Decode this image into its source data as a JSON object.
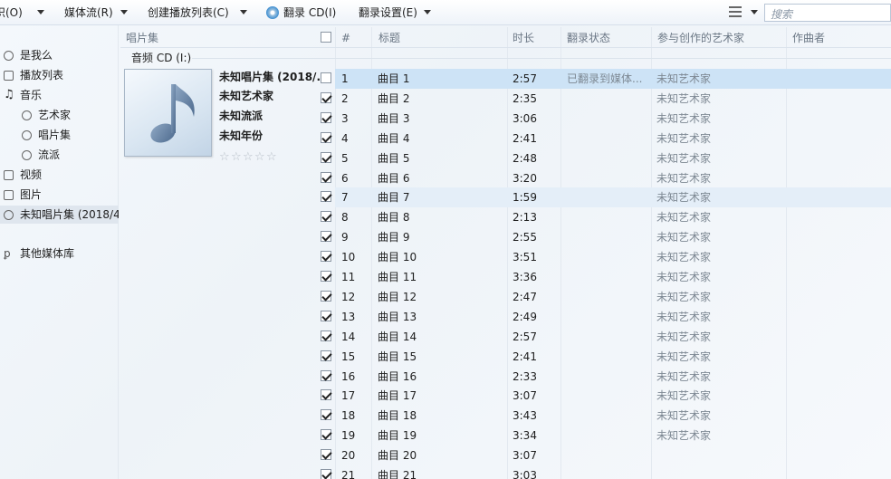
{
  "toolbar": {
    "organize": "织(O)",
    "stream": "媒体流(R)",
    "create_playlist": "创建播放列表(C)",
    "rip_cd": "翻录 CD(I)",
    "rip_settings": "翻录设置(E)",
    "search_placeholder": "搜索"
  },
  "nav": {
    "items": [
      {
        "label": "是我么",
        "icon": "user-icon"
      },
      {
        "label": "播放列表",
        "icon": "playlist-icon"
      },
      {
        "label": "音乐",
        "icon": "music-note-icon"
      },
      {
        "label": "艺术家",
        "icon": "artist-icon"
      },
      {
        "label": "唱片集",
        "icon": "album-icon"
      },
      {
        "label": "流派",
        "icon": "genre-icon"
      },
      {
        "label": "视频",
        "icon": "video-icon"
      },
      {
        "label": "图片",
        "icon": "picture-icon"
      },
      {
        "label": "未知唱片集 (2018/4",
        "icon": "cd-icon"
      },
      {
        "label": "其他媒体库",
        "icon": "other-library-icon"
      }
    ]
  },
  "columns": {
    "album": "唱片集",
    "number": "#",
    "title": "标题",
    "duration": "时长",
    "rip_status": "翻录状态",
    "contributing_artist": "参与创作的艺术家",
    "composer": "作曲者"
  },
  "group": {
    "label": "音频 CD (I:)"
  },
  "album": {
    "name": "未知唱片集 (2018/...",
    "artist": "未知艺术家",
    "genre": "未知流派",
    "year": "未知年份",
    "rating": 0,
    "rating_max": 5
  },
  "tracks": [
    {
      "checked": false,
      "num": "1",
      "title": "曲目 1",
      "duration": "2:57",
      "rip_status": "已翻录到媒体...",
      "artist": "未知艺术家"
    },
    {
      "checked": true,
      "num": "2",
      "title": "曲目 2",
      "duration": "2:35",
      "rip_status": "",
      "artist": "未知艺术家"
    },
    {
      "checked": true,
      "num": "3",
      "title": "曲目 3",
      "duration": "3:06",
      "rip_status": "",
      "artist": "未知艺术家"
    },
    {
      "checked": true,
      "num": "4",
      "title": "曲目 4",
      "duration": "2:41",
      "rip_status": "",
      "artist": "未知艺术家"
    },
    {
      "checked": true,
      "num": "5",
      "title": "曲目 5",
      "duration": "2:48",
      "rip_status": "",
      "artist": "未知艺术家"
    },
    {
      "checked": true,
      "num": "6",
      "title": "曲目 6",
      "duration": "3:20",
      "rip_status": "",
      "artist": "未知艺术家"
    },
    {
      "checked": true,
      "num": "7",
      "title": "曲目 7",
      "duration": "1:59",
      "rip_status": "",
      "artist": "未知艺术家"
    },
    {
      "checked": true,
      "num": "8",
      "title": "曲目 8",
      "duration": "2:13",
      "rip_status": "",
      "artist": "未知艺术家"
    },
    {
      "checked": true,
      "num": "9",
      "title": "曲目 9",
      "duration": "2:55",
      "rip_status": "",
      "artist": "未知艺术家"
    },
    {
      "checked": true,
      "num": "10",
      "title": "曲目 10",
      "duration": "3:51",
      "rip_status": "",
      "artist": "未知艺术家"
    },
    {
      "checked": true,
      "num": "11",
      "title": "曲目 11",
      "duration": "3:36",
      "rip_status": "",
      "artist": "未知艺术家"
    },
    {
      "checked": true,
      "num": "12",
      "title": "曲目 12",
      "duration": "2:47",
      "rip_status": "",
      "artist": "未知艺术家"
    },
    {
      "checked": true,
      "num": "13",
      "title": "曲目 13",
      "duration": "2:49",
      "rip_status": "",
      "artist": "未知艺术家"
    },
    {
      "checked": true,
      "num": "14",
      "title": "曲目 14",
      "duration": "2:57",
      "rip_status": "",
      "artist": "未知艺术家"
    },
    {
      "checked": true,
      "num": "15",
      "title": "曲目 15",
      "duration": "2:41",
      "rip_status": "",
      "artist": "未知艺术家"
    },
    {
      "checked": true,
      "num": "16",
      "title": "曲目 16",
      "duration": "2:33",
      "rip_status": "",
      "artist": "未知艺术家"
    },
    {
      "checked": true,
      "num": "17",
      "title": "曲目 17",
      "duration": "3:07",
      "rip_status": "",
      "artist": "未知艺术家"
    },
    {
      "checked": true,
      "num": "18",
      "title": "曲目 18",
      "duration": "3:43",
      "rip_status": "",
      "artist": "未知艺术家"
    },
    {
      "checked": true,
      "num": "19",
      "title": "曲目 19",
      "duration": "3:34",
      "rip_status": "",
      "artist": "未知艺术家"
    },
    {
      "checked": true,
      "num": "20",
      "title": "曲目 20",
      "duration": "3:07",
      "rip_status": "",
      "artist": ""
    },
    {
      "checked": true,
      "num": "21",
      "title": "曲目 21",
      "duration": "3:03",
      "rip_status": "",
      "artist": ""
    }
  ]
}
